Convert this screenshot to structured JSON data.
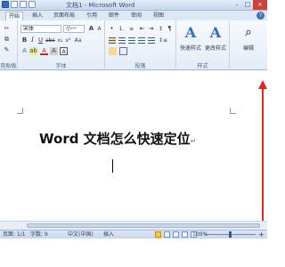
{
  "window": {
    "title": "文档1 - Microsoft Word"
  },
  "tabs": [
    {
      "label": "开始",
      "active": true
    },
    {
      "label": "插入"
    },
    {
      "label": "页面布局"
    },
    {
      "label": "引用"
    },
    {
      "label": "邮件"
    },
    {
      "label": "审阅"
    },
    {
      "label": "视图"
    }
  ],
  "ribbon": {
    "font_name": "宋体",
    "font_size": "小一",
    "groups": {
      "clipboard": "剪贴板",
      "font": "字体",
      "paragraph": "段落",
      "styles": "样式",
      "editing": "编辑"
    },
    "quick_styles_label": "快速样式",
    "change_styles_label": "更改样式",
    "editing_label": "编辑"
  },
  "document": {
    "heading": "Word 文档怎么快速定位",
    "paragraph_mark": "↵"
  },
  "status": {
    "page": "页面: 1/1",
    "words": "字数: 9",
    "language": "中文(中国)",
    "mode": "插入",
    "zoom": "100%"
  },
  "colors": {
    "annotation_arrow": "#e8231c",
    "accent": "#2f6bc5"
  }
}
